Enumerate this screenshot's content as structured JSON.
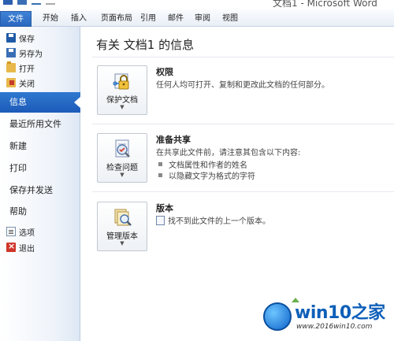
{
  "window": {
    "title": "文档1 - Microsoft Word"
  },
  "ribbon": {
    "tabs": [
      {
        "label": "文件"
      },
      {
        "label": "开始"
      },
      {
        "label": "插入"
      },
      {
        "label": "页面布局"
      },
      {
        "label": "引用"
      },
      {
        "label": "邮件"
      },
      {
        "label": "审阅"
      },
      {
        "label": "视图"
      }
    ]
  },
  "sidebar": {
    "commands": [
      {
        "label": "保存",
        "icon": "save-icon"
      },
      {
        "label": "另存为",
        "icon": "save-as-icon"
      },
      {
        "label": "打开",
        "icon": "open-folder-icon"
      },
      {
        "label": "关闭",
        "icon": "close-folder-icon"
      }
    ],
    "items": [
      {
        "label": "信息",
        "active": true
      },
      {
        "label": "最近所用文件"
      },
      {
        "label": "新建"
      },
      {
        "label": "打印"
      },
      {
        "label": "保存并发送"
      },
      {
        "label": "帮助"
      }
    ],
    "bottom": [
      {
        "label": "选项",
        "icon": "options-icon"
      },
      {
        "label": "退出",
        "icon": "exit-icon"
      }
    ]
  },
  "main": {
    "title": "有关 文档1 的信息",
    "permissions": {
      "button_label": "保护文档",
      "icon": "lock-key-icon",
      "title": "权限",
      "description": "任何人均可打开、复制和更改此文档的任何部分。"
    },
    "sharing": {
      "button_label": "检查问题",
      "icon": "inspect-document-icon",
      "title": "准备共享",
      "description": "在共享此文件前，请注意其包含以下内容:",
      "bullets": [
        "文档属性和作者的姓名",
        "以隐藏文字为格式的字符"
      ]
    },
    "versions": {
      "button_label": "管理版本",
      "icon": "manage-versions-icon",
      "title": "版本",
      "description": "找不到此文件的上一个版本。"
    }
  },
  "watermark": {
    "brand": "win10之家",
    "url": "www.2016win10.com"
  },
  "colors": {
    "file_tab": "#2a68bf",
    "active_nav": "#1d5bb8",
    "watermark": "#0e5fb9"
  }
}
